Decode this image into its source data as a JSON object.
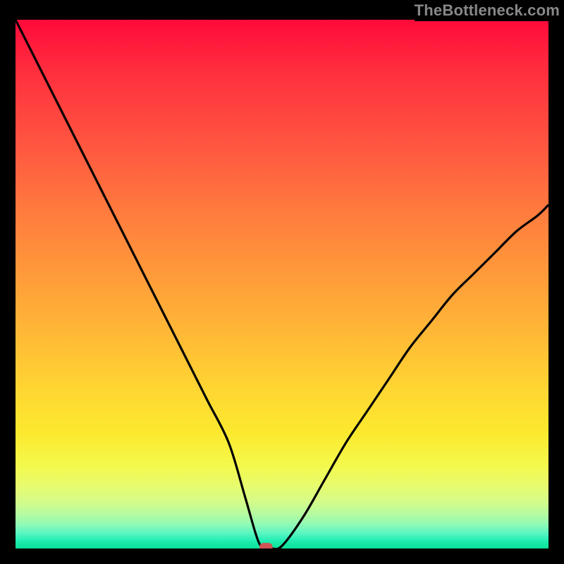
{
  "watermark": "TheBottleneck.com",
  "colors": {
    "background": "#000000",
    "gradient_top": "#ff0a3a",
    "gradient_mid": "#ffd632",
    "gradient_bottom": "#0ce29b",
    "curve": "#000000",
    "marker": "#d05555"
  },
  "chart_data": {
    "type": "line",
    "title": "",
    "xlabel": "",
    "ylabel": "",
    "xlim": [
      0,
      100
    ],
    "ylim": [
      0,
      100
    ],
    "annotations": [],
    "marker": {
      "x": 47,
      "y": 0
    },
    "series": [
      {
        "name": "curve",
        "x": [
          0,
          4,
          8,
          12,
          16,
          20,
          24,
          28,
          32,
          36,
          40,
          43,
          45,
          46,
          47,
          48,
          50,
          54,
          58,
          62,
          66,
          70,
          74,
          78,
          82,
          86,
          90,
          94,
          98,
          100
        ],
        "values": [
          100,
          92,
          84,
          76,
          68,
          60,
          52,
          44,
          36,
          28,
          20,
          10,
          3,
          0.5,
          0,
          0,
          0.5,
          6,
          13,
          20,
          26,
          32,
          38,
          43,
          48,
          52,
          56,
          60,
          63,
          65
        ]
      }
    ]
  }
}
